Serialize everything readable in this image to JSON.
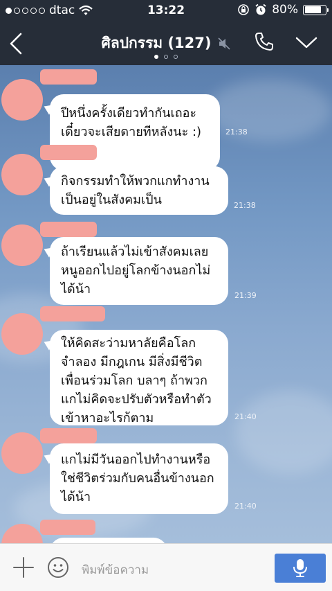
{
  "status_bar": {
    "carrier": "dtac",
    "time": "13:22",
    "battery_percent": "80%",
    "battery_level": 0.8,
    "signal_bars_on": 1
  },
  "header": {
    "title": "ศิลปกรรม (127)",
    "pages": 3,
    "active_page": 0
  },
  "messages": [
    {
      "text": "ปีหนึ่งครั้งเดียวทำกันเถอะ\nเดี๋ยวจะเสียดายทีหลังนะ :)",
      "time": "21:38"
    },
    {
      "text": "กิจกรรมทำให้พวกแกทำงาน\nเป็นอยู่ในสังคมเป็น",
      "time": "21:38"
    },
    {
      "text": "ถ้าเรียนแล้วไม่เข้าสังคมเลย\nหนูออกไปอยู่โลกข้างนอกไม่\nได้น้า",
      "time": "21:39"
    },
    {
      "text": "ให้คิดสะว่ามหาลัยคือโลก\nจำลอง มีกฎเกน มีสิ่งมีชีวิต\nเพื่อนร่วมโลก บลาๆ ถ้าพวก\nแกไม่คิดจะปรับตัวหรือทำตัว\nเข้าหาอะไรก้ตาม",
      "time": "21:40"
    },
    {
      "text": "แกไม่มีวันออกไปทำงานหรือ\nใช่ชีวิตร่วมกับคนอื่นข้างนอก\nได้น้า",
      "time": "21:40"
    }
  ],
  "input": {
    "placeholder": "พิมพ์ข้อความ"
  },
  "colors": {
    "header_bg": "#262d38",
    "avatar_blur": "#f4a19b",
    "mic_button": "#4a7fd6"
  }
}
